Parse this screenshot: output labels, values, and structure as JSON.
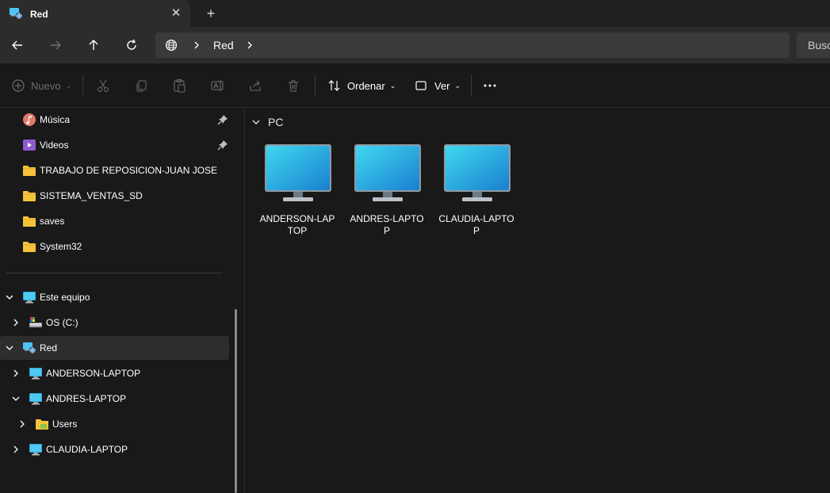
{
  "window": {
    "tab_title": "Red",
    "tab_icon": "network-icon",
    "close_icon": "close-icon",
    "new_tab_icon": "plus-icon"
  },
  "navigation": {
    "back_icon": "back-arrow-icon",
    "forward_icon": "forward-arrow-icon",
    "up_icon": "up-arrow-icon",
    "refresh_icon": "refresh-icon",
    "breadcrumb": [
      "Red"
    ],
    "search_placeholder": "Busc"
  },
  "commands": {
    "new_label": "Nuevo",
    "sort_label": "Ordenar",
    "view_label": "Ver",
    "more_icon": "ellipsis-icon",
    "icons": [
      "cut-icon",
      "copy-icon",
      "paste-icon",
      "rename-icon",
      "share-icon",
      "delete-icon"
    ]
  },
  "sidebar": {
    "quick_access": [
      {
        "label": "Música",
        "icon": "music-icon",
        "pinned": true
      },
      {
        "label": "Videos",
        "icon": "video-icon",
        "pinned": true
      },
      {
        "label": "TRABAJO DE REPOSICION-JUAN JOSE",
        "icon": "folder-icon",
        "pinned": false
      },
      {
        "label": "SISTEMA_VENTAS_SD",
        "icon": "folder-icon",
        "pinned": false
      },
      {
        "label": "saves",
        "icon": "folder-icon",
        "pinned": false
      },
      {
        "label": "System32",
        "icon": "folder-icon",
        "pinned": false
      }
    ],
    "tree": [
      {
        "label": "Este equipo",
        "icon": "computer-icon",
        "expanded": true,
        "level": 0
      },
      {
        "label": "OS (C:)",
        "icon": "drive-icon",
        "expanded": false,
        "level": 1
      },
      {
        "label": "Red",
        "icon": "network-icon",
        "expanded": true,
        "level": 0,
        "selected": true
      },
      {
        "label": "ANDERSON-LAPTOP",
        "icon": "computer-icon",
        "expanded": false,
        "level": 1
      },
      {
        "label": "ANDRES-LAPTOP",
        "icon": "computer-icon",
        "expanded": true,
        "level": 1
      },
      {
        "label": "Users",
        "icon": "folder-icon",
        "expanded": false,
        "level": 2
      },
      {
        "label": "CLAUDIA-LAPTOP",
        "icon": "computer-icon",
        "expanded": false,
        "level": 1
      }
    ]
  },
  "main": {
    "group_label": "PC",
    "items": [
      {
        "label": "ANDERSON-LAPTOP",
        "icon": "monitor-icon"
      },
      {
        "label": "ANDRES-LAPTOP",
        "icon": "monitor-icon"
      },
      {
        "label": "CLAUDIA-LAPTOP",
        "icon": "monitor-icon"
      }
    ]
  },
  "colors": {
    "background": "#191919",
    "tab_bar": "#202020",
    "toolbar": "#2c2c2c",
    "selected": "#2d2d2d",
    "folder": "#f5c33b",
    "monitor": "#2bb5e0"
  }
}
